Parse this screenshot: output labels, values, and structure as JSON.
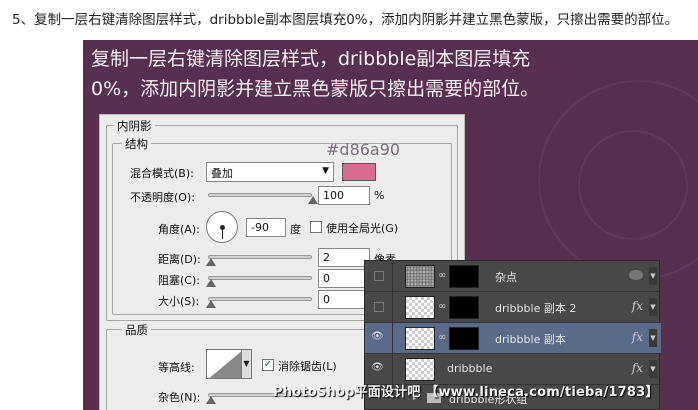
{
  "heading": "5、复制一层右键清除图层样式，dribbble副本图层填充0%，添加内阴影并建立黑色蒙版，只擦出需要的部位。",
  "canvas": {
    "text": "复制一层右键清除图层样式，dribbble副本图层填充0%，添加内阴影并建立黑色蒙版只擦出需要的部位。",
    "background": "#58304f"
  },
  "dialog": {
    "title": "内阴影",
    "structure_label": "结构",
    "blend_mode_label": "混合模式(B):",
    "blend_mode_value": "叠加",
    "color_hex_label": "#d86a90",
    "color": "#d86a90",
    "opacity_label": "不透明度(O):",
    "opacity_value": "100",
    "opacity_unit": "%",
    "opacity_level": 1.0,
    "angle_label": "角度(A):",
    "angle_value": "-90",
    "angle_unit": "度",
    "global_light_label": "使用全局光(G)",
    "global_light_checked": false,
    "distance_label": "距离(D):",
    "distance_value": "2",
    "distance_unit": "像素",
    "choke_label": "阻塞(C):",
    "choke_value": "0",
    "size_label": "大小(S):",
    "size_value": "0",
    "quality_label": "品质",
    "contour_label": "等高线:",
    "antialias_label": "消除锯齿(L)",
    "antialias_checked": true,
    "noise_label": "杂色(N):"
  },
  "layers": {
    "rows": [
      {
        "name": "杂点",
        "visible": false,
        "thumb": "noise",
        "mask": true,
        "fx": false,
        "selected": false
      },
      {
        "name": "dribbble 副本 2",
        "visible": false,
        "thumb": "checker",
        "mask": true,
        "fx": true,
        "selected": false
      },
      {
        "name": "dribbble 副本",
        "visible": true,
        "thumb": "checker",
        "mask": true,
        "fx": true,
        "selected": true
      },
      {
        "name": "dribbble",
        "visible": true,
        "thumb": "checker",
        "mask": false,
        "fx": true,
        "selected": false
      }
    ],
    "group_name": "dribbble形状组",
    "fx_label": "fx"
  },
  "watermark": "PhotoShop平面设计吧 【www.lineca.com/tieba/1783】"
}
